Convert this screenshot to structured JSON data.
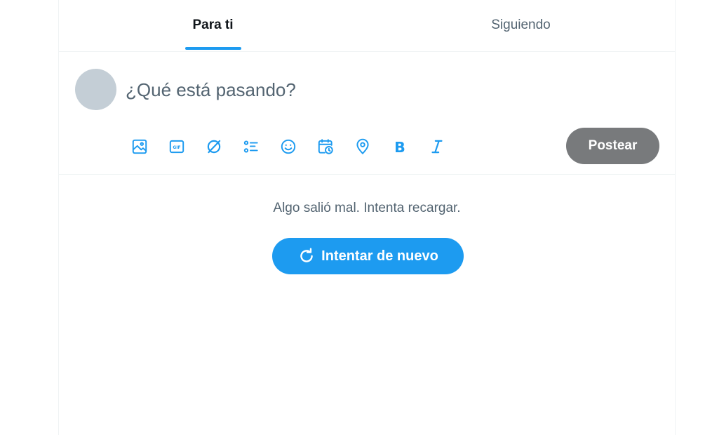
{
  "colors": {
    "accent": "#1d9bf0",
    "text_primary": "#0f1419",
    "text_secondary": "#536471",
    "post_button_disabled": "#787a7c",
    "avatar_placeholder": "#c4ced6"
  },
  "tabs": [
    {
      "label": "Para ti",
      "active": true
    },
    {
      "label": "Siguiendo",
      "active": false
    }
  ],
  "composer": {
    "placeholder": "¿Qué está pasando?",
    "value": "",
    "toolbar_icons": [
      "image-icon",
      "gif-icon",
      "grok-icon",
      "poll-icon",
      "emoji-icon",
      "schedule-icon",
      "location-icon",
      "bold-icon",
      "italic-icon"
    ],
    "post_label": "Postear"
  },
  "error": {
    "message": "Algo salió mal. Intenta recargar.",
    "retry_label": "Intentar de nuevo",
    "retry_icon": "refresh-icon"
  }
}
